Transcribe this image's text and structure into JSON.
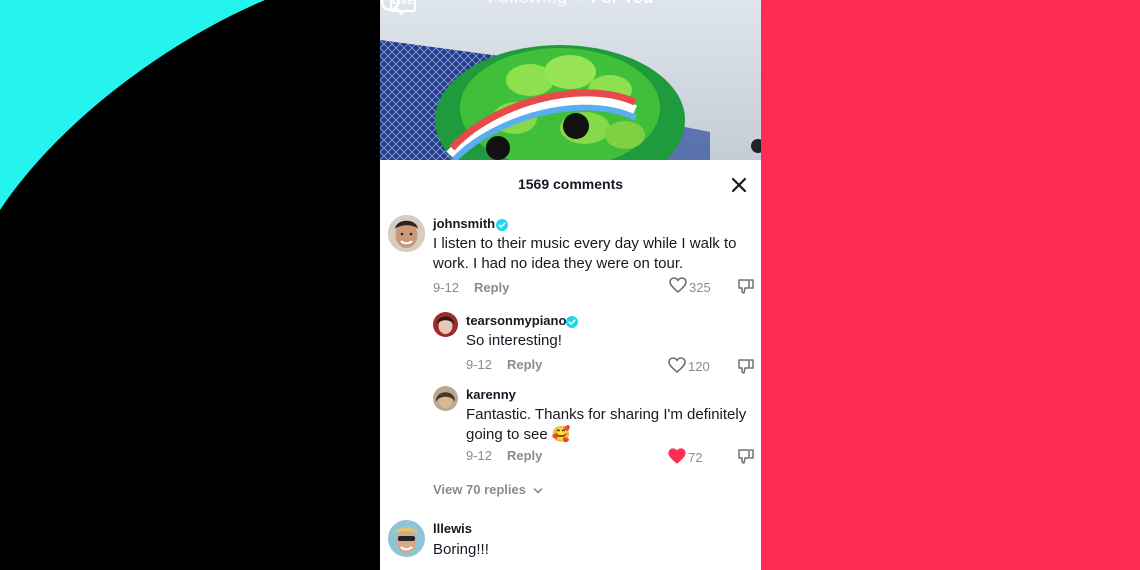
{
  "colors": {
    "cyan": "#25f4ee",
    "pink": "#fe2c55",
    "black": "#000000",
    "verified": "#20d5ec",
    "liked": "#fe2c55",
    "muted": "#8a8b91"
  },
  "topbar": {
    "live_label": "LIVE",
    "tab_following": "Following",
    "tab_foryou": "For You"
  },
  "sheet": {
    "comment_count": "1569 comments"
  },
  "comments": [
    {
      "username": "johnsmith",
      "verified": true,
      "text": "I listen to their music every day while I walk to work. I had no idea they were on tour.",
      "date": "9-12",
      "reply_label": "Reply",
      "likes": "325",
      "liked": false
    },
    {
      "username": "tearsonmypiano",
      "verified": true,
      "text": "So interesting!",
      "date": "9-12",
      "reply_label": "Reply",
      "likes": "120",
      "liked": false
    },
    {
      "username": "karenny",
      "verified": false,
      "text": "Fantastic. Thanks for sharing I'm definitely going to see 🥰",
      "date": "9-12",
      "reply_label": "Reply",
      "likes": "72",
      "liked": true
    },
    {
      "username": "lllewis",
      "verified": false,
      "text": "Boring!!!"
    }
  ],
  "view_replies": "View 70 replies"
}
